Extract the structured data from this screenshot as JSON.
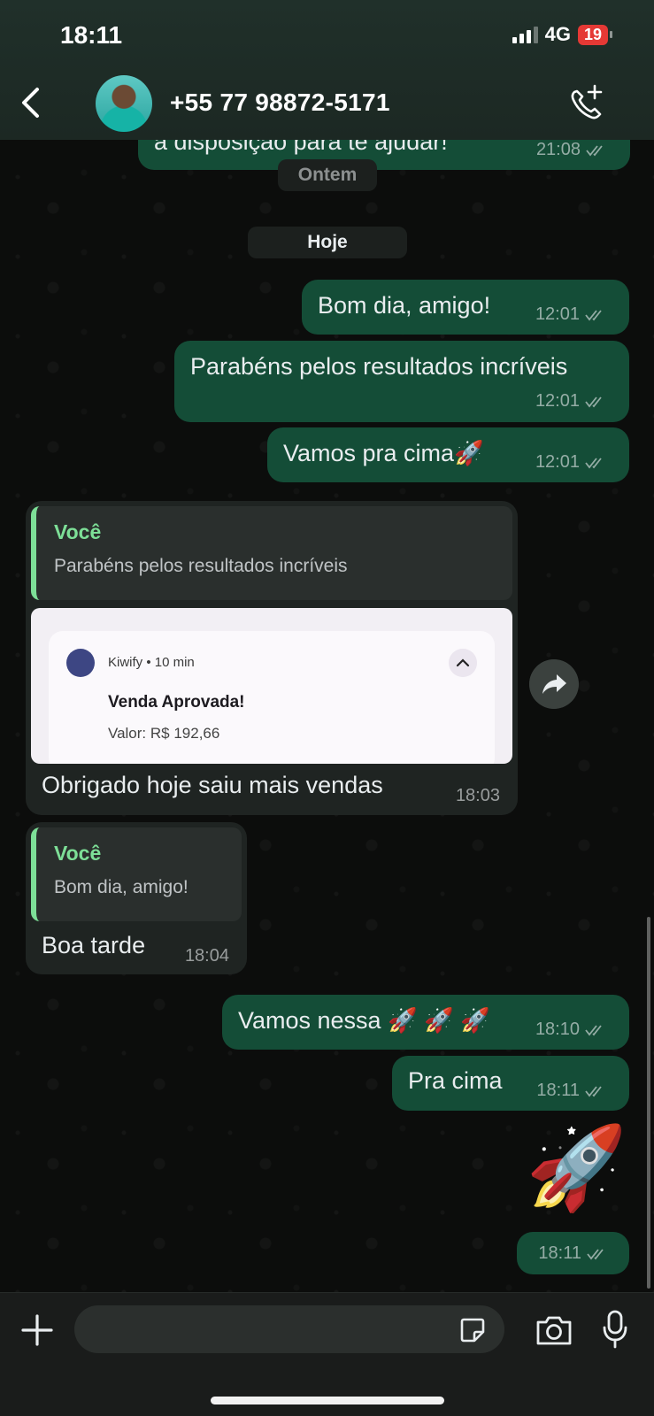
{
  "status_bar": {
    "time": "18:11",
    "network": "4G",
    "battery": "19"
  },
  "header": {
    "contact": "+55 77 98872-5171"
  },
  "messages": {
    "prev_partial": {
      "text": "à disposição para te ajudar!",
      "time": "21:08"
    },
    "day_ontem": "Ontem",
    "day_hoje": "Hoje",
    "m1": {
      "text": "Bom dia, amigo!",
      "time": "12:01"
    },
    "m2": {
      "text": "Parabéns pelos resultados incríveis",
      "time": "12:01"
    },
    "m3": {
      "text": "Vamos pra cima🚀",
      "time": "12:01"
    },
    "r1": {
      "quote_author": "Você",
      "quote_text": "Parabéns pelos resultados incríveis",
      "notif_app": "Kiwify • 10 min",
      "notif_title": "Venda Aprovada!",
      "notif_body": "Valor: R$ 192,66",
      "text": "Obrigado hoje saiu mais vendas",
      "time": "18:03"
    },
    "r2": {
      "quote_author": "Você",
      "quote_text": "Bom dia, amigo!",
      "text": "Boa tarde",
      "time": "18:04"
    },
    "m4": {
      "text": "Vamos nessa 🚀 🚀 🚀",
      "time": "18:10"
    },
    "m5": {
      "text": "Pra cima",
      "time": "18:11"
    },
    "m6": {
      "emoji": "🚀",
      "time": "18:11"
    }
  },
  "composer": {
    "placeholder": ""
  },
  "icons": [
    "back-icon",
    "phone-add-icon",
    "plus-icon",
    "sticker-icon",
    "camera-icon",
    "mic-icon",
    "forward-icon",
    "double-check-icon"
  ],
  "colors": {
    "outgoing": "#144d37",
    "incoming": "#1f2422",
    "accent": "#7ddf97"
  }
}
